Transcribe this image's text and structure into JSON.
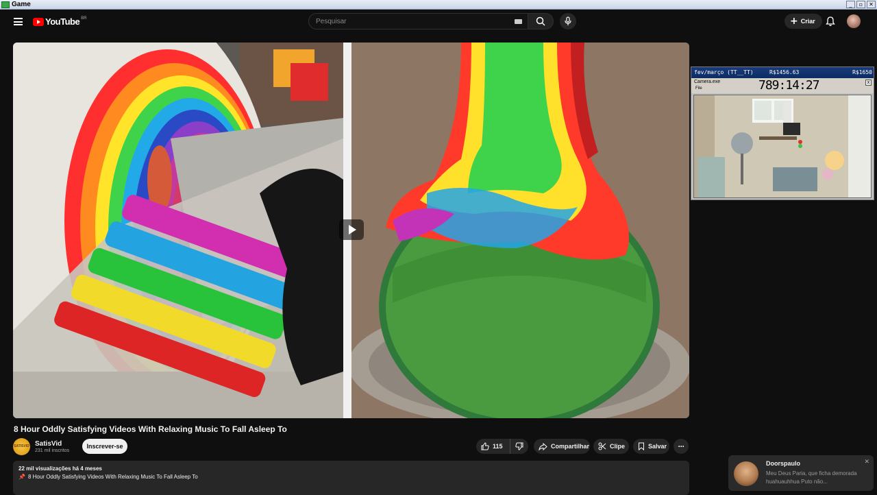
{
  "window": {
    "title": "Game",
    "controls": [
      "_",
      "▫",
      "✕"
    ]
  },
  "header": {
    "logo_text": "YouTube",
    "country": "BR",
    "search_placeholder": "Pesquisar",
    "create_label": "Criar"
  },
  "video": {
    "title": "8 Hour Oddly Satisfying Videos With Relaxing Music To Fall Asleep To",
    "channel_name": "SatisVid",
    "channel_subs": "231 mil inscritos",
    "channel_avatar_text": "SATISVID",
    "subscribe_label": "Inscrever-se",
    "likes": "115",
    "share_label": "Compartilhar",
    "clip_label": "Clipe",
    "save_label": "Salvar",
    "more_label": "···"
  },
  "description": {
    "stats": "22 mil visualizações  há 4 meses",
    "first_line": "8 Hour Oddly Satisfying Videos With Relaxing Music To Fall Asleep To"
  },
  "overlay": {
    "period": "fev/março (TT__TT)",
    "money1": "R$1456.63",
    "money2": "R$1650",
    "cam_title": "Camera.exe",
    "file_menu": "File",
    "timer": "789:14:27",
    "close": "x"
  },
  "toast": {
    "name": "Doorspaulo",
    "message": "Meu Deus Paria, que ficha demorada huahuauhhua  Puto não...",
    "close": "✕"
  },
  "colors": {
    "background": "#0f0f0f",
    "brand_red": "#ff0000",
    "pill": "#272727"
  }
}
